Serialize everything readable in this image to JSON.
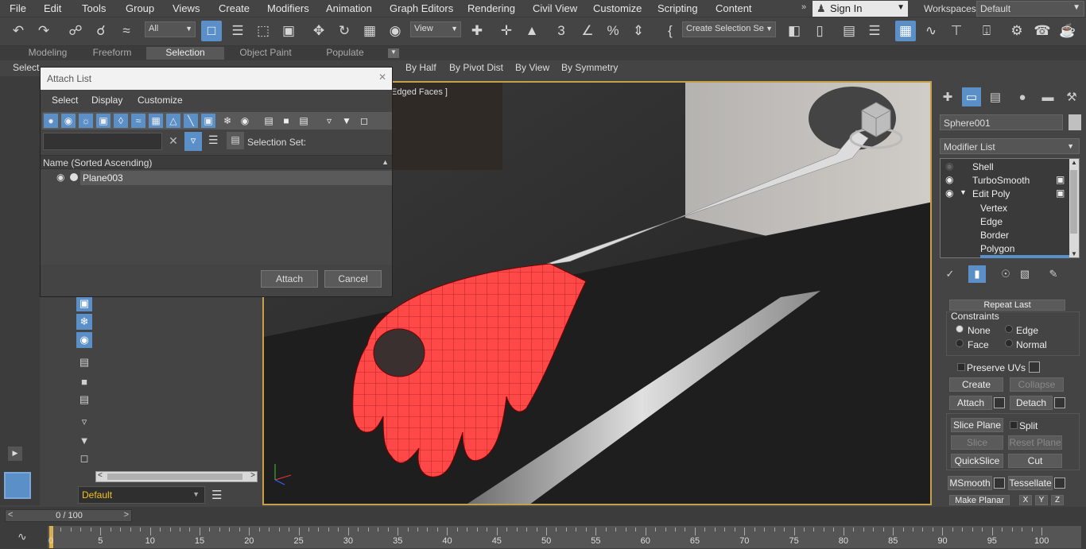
{
  "menubar": {
    "items": [
      "File",
      "Edit",
      "Tools",
      "Group",
      "Views",
      "Create",
      "Modifiers",
      "Animation",
      "Graph Editors",
      "Rendering",
      "Civil View",
      "Customize",
      "Scripting",
      "Content"
    ],
    "sign_in": "Sign In",
    "workspaces_label": "Workspaces:",
    "workspace_value": "Default"
  },
  "toolbar": {
    "filter_value": "All",
    "refcoord_value": "View",
    "selection_set_placeholder": "Create Selection Se"
  },
  "ribbon": {
    "tabs": [
      "Modeling",
      "Freeform",
      "Selection",
      "Object Paint",
      "Populate"
    ],
    "active_tab": "Selection"
  },
  "subbar": {
    "items": [
      "Select",
      "By Half",
      "By Pivot Dist",
      "By View",
      "By Symmetry"
    ]
  },
  "viewport": {
    "label": "Edged Faces ]"
  },
  "dialog": {
    "title": "Attach List",
    "menu": [
      "Select",
      "Display",
      "Customize"
    ],
    "selection_set_label": "Selection Set:",
    "column_header": "Name (Sorted Ascending)",
    "rows": [
      "Plane003"
    ],
    "attach_label": "Attach",
    "cancel_label": "Cancel"
  },
  "scene_explorer": {
    "layer_value": "Default"
  },
  "command_panel": {
    "object_name": "Sphere001",
    "object_color": "#c0c0c0",
    "modifier_list": "Modifier List",
    "stack": {
      "shell": "Shell",
      "turbosmooth": "TurboSmooth",
      "edit_poly": "Edit Poly",
      "vertex": "Vertex",
      "edge": "Edge",
      "border": "Border",
      "polygon": "Polygon"
    },
    "repeat_last": "Repeat Last",
    "constraints_label": "Constraints",
    "constraint_none": "None",
    "constraint_edge": "Edge",
    "constraint_face": "Face",
    "constraint_normal": "Normal",
    "preserve_uvs": "Preserve UVs",
    "create": "Create",
    "collapse": "Collapse",
    "attach": "Attach",
    "detach": "Detach",
    "slice_plane": "Slice Plane",
    "split": "Split",
    "slice": "Slice",
    "reset_plane": "Reset Plane",
    "quickslice": "QuickSlice",
    "cut": "Cut",
    "msmooth": "MSmooth",
    "tessellate": "Tessellate",
    "make_planar": "Make Planar",
    "x": "X",
    "y": "Y",
    "z": "Z"
  },
  "timeline": {
    "frame_text": "0 / 100",
    "ticks": [
      "0",
      "5",
      "10",
      "15",
      "20",
      "25",
      "30",
      "35",
      "40",
      "45",
      "50",
      "55",
      "60",
      "65",
      "70",
      "75",
      "80",
      "85",
      "90",
      "95",
      "100"
    ]
  },
  "colors": {
    "accent": "#5b8fc7",
    "viewport_border": "#c8a048",
    "mesh_selected": "#ff4040",
    "layer_text": "#f0c020"
  }
}
